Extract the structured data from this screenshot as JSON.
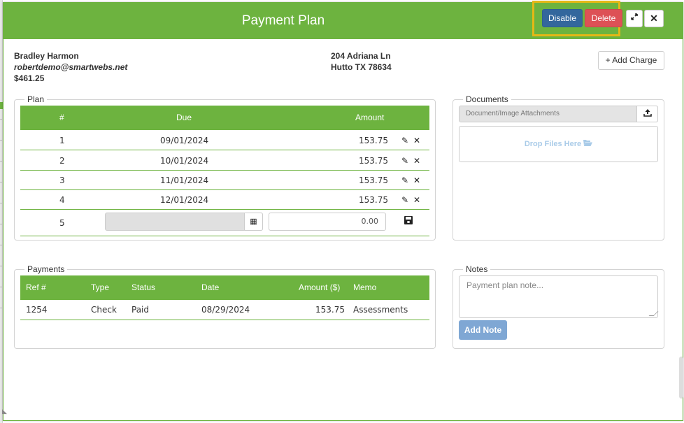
{
  "header": {
    "title": "Payment Plan",
    "disable_label": "Disable",
    "delete_label": "Delete",
    "expand_icon": "expand-icon",
    "close_icon": "close-icon"
  },
  "owner": {
    "name": "Bradley Harmon",
    "email": "robertdemo@smartwebs.net",
    "balance": "$461.25",
    "address_line1": "204 Adriana Ln",
    "address_line2": "Hutto TX 78634"
  },
  "add_charge_label": "+ Add Charge",
  "plan": {
    "legend": "Plan",
    "headers": {
      "num": "#",
      "due": "Due",
      "amount": "Amount"
    },
    "rows": [
      {
        "num": "1",
        "due": "09/01/2024",
        "amount": "153.75"
      },
      {
        "num": "2",
        "due": "10/01/2024",
        "amount": "153.75"
      },
      {
        "num": "3",
        "due": "11/01/2024",
        "amount": "153.75"
      },
      {
        "num": "4",
        "due": "12/01/2024",
        "amount": "153.75"
      }
    ],
    "new_row": {
      "num": "5",
      "due_value": "",
      "amount_value": "0.00"
    },
    "row_icons": {
      "edit": "edit-icon",
      "delete": "delete-icon",
      "save": "save-icon",
      "calendar": "calendar-icon"
    }
  },
  "payments": {
    "legend": "Payments",
    "headers": {
      "ref": "Ref #",
      "type": "Type",
      "status": "Status",
      "date": "Date",
      "amount": "Amount ($)",
      "memo": "Memo"
    },
    "rows": [
      {
        "ref": "1254",
        "type": "Check",
        "status": "Paid",
        "date": "08/29/2024",
        "amount": "153.75",
        "memo": "Assessments"
      }
    ]
  },
  "documents": {
    "legend": "Documents",
    "attachments_label": "Document/Image Attachments",
    "drop_label": "Drop Files Here",
    "upload_icon": "upload-icon",
    "folder_icon": "folder-open-icon"
  },
  "notes": {
    "legend": "Notes",
    "placeholder": "Payment plan note...",
    "add_note_label": "Add Note"
  },
  "colors": {
    "header_green": "#6db33f",
    "disable_blue": "#33679d",
    "delete_red": "#dd5156",
    "highlight_yellow": "#e5b816",
    "add_note_blue": "#7fa7d4"
  }
}
